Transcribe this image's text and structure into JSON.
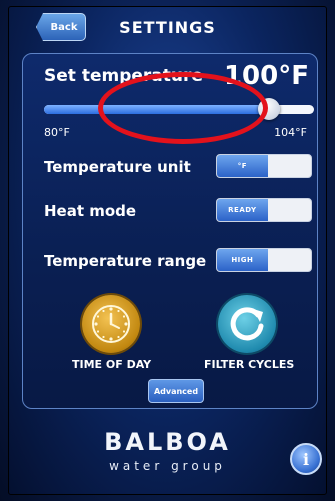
{
  "header": {
    "back_label": "Back",
    "title": "SETTINGS"
  },
  "set_temperature": {
    "label": "Set temperature",
    "value": "100°F",
    "min_label": "80°F",
    "max_label": "104°F",
    "slider_fraction": 0.833
  },
  "rows": [
    {
      "label": "Temperature unit",
      "toggle_text": "°F"
    },
    {
      "label": "Heat mode",
      "toggle_text": "READY"
    },
    {
      "label": "Temperature range",
      "toggle_text": "HIGH"
    }
  ],
  "shortcuts": {
    "time_of_day": "TIME OF DAY",
    "filter_cycles": "FILTER CYCLES",
    "advanced": "Advanced"
  },
  "branding": {
    "name": "BALBOA",
    "subtitle": "water group"
  },
  "colors": {
    "accent_blue": "#2c6ee0",
    "highlight_red": "#e3121c"
  }
}
